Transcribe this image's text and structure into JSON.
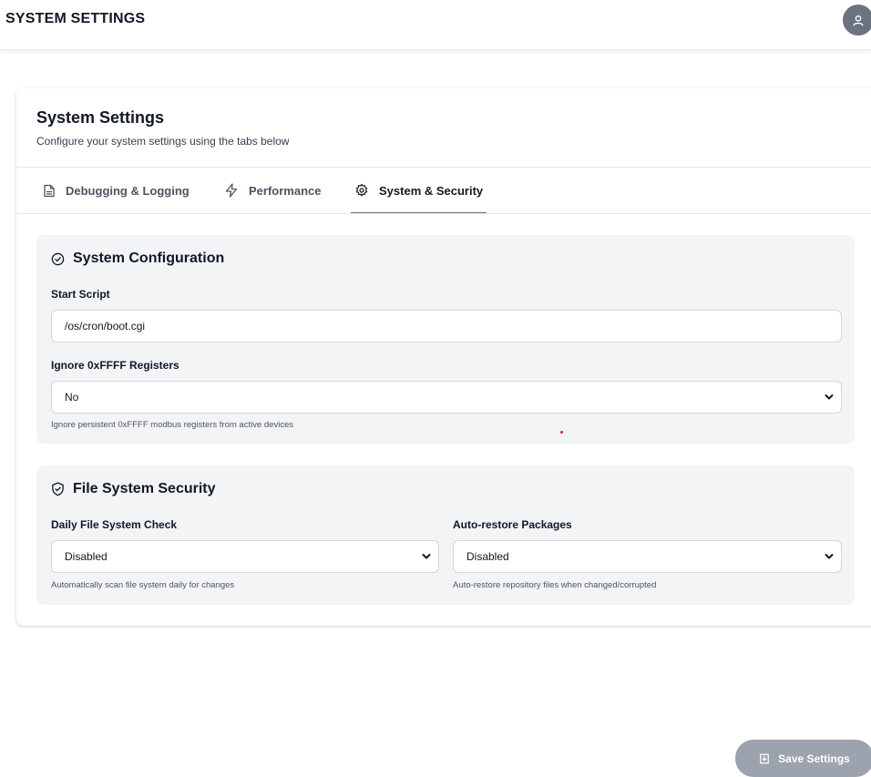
{
  "topbar": {
    "title": "SYSTEM SETTINGS",
    "avatar_icon": "user-icon"
  },
  "card": {
    "title": "System Settings",
    "subtitle": "Configure your system settings using the tabs below"
  },
  "tabs": [
    {
      "label": "Debugging & Logging",
      "icon": "document-icon",
      "active": false
    },
    {
      "label": "Performance",
      "icon": "lightning-icon",
      "active": false
    },
    {
      "label": "System & Security",
      "icon": "gear-icon",
      "active": true
    }
  ],
  "system_config": {
    "title": "System Configuration",
    "icon": "check-circle-icon",
    "start_script": {
      "label": "Start Script",
      "value": "/os/cron/boot.cgi"
    },
    "ignore_registers": {
      "label": "Ignore 0xFFFF Registers",
      "value": "No",
      "help": "Ignore persistent 0xFFFF modbus registers from active devices"
    }
  },
  "fs_security": {
    "title": "File System Security",
    "icon": "shield-check-icon",
    "daily_check": {
      "label": "Daily File System Check",
      "value": "Disabled",
      "help": "Automatically scan file system daily for changes"
    },
    "auto_restore": {
      "label": "Auto-restore Packages",
      "value": "Disabled",
      "help": "Auto-restore repository files when changed/corrupted"
    }
  },
  "save_button": {
    "label": "Save Settings",
    "icon": "save-icon"
  },
  "colors": {
    "section_bg": "#f3f4f6",
    "save_button_bg": "#9ca3af",
    "avatar_bg": "#6b7280",
    "active_tab_underline": "#6b7280"
  }
}
